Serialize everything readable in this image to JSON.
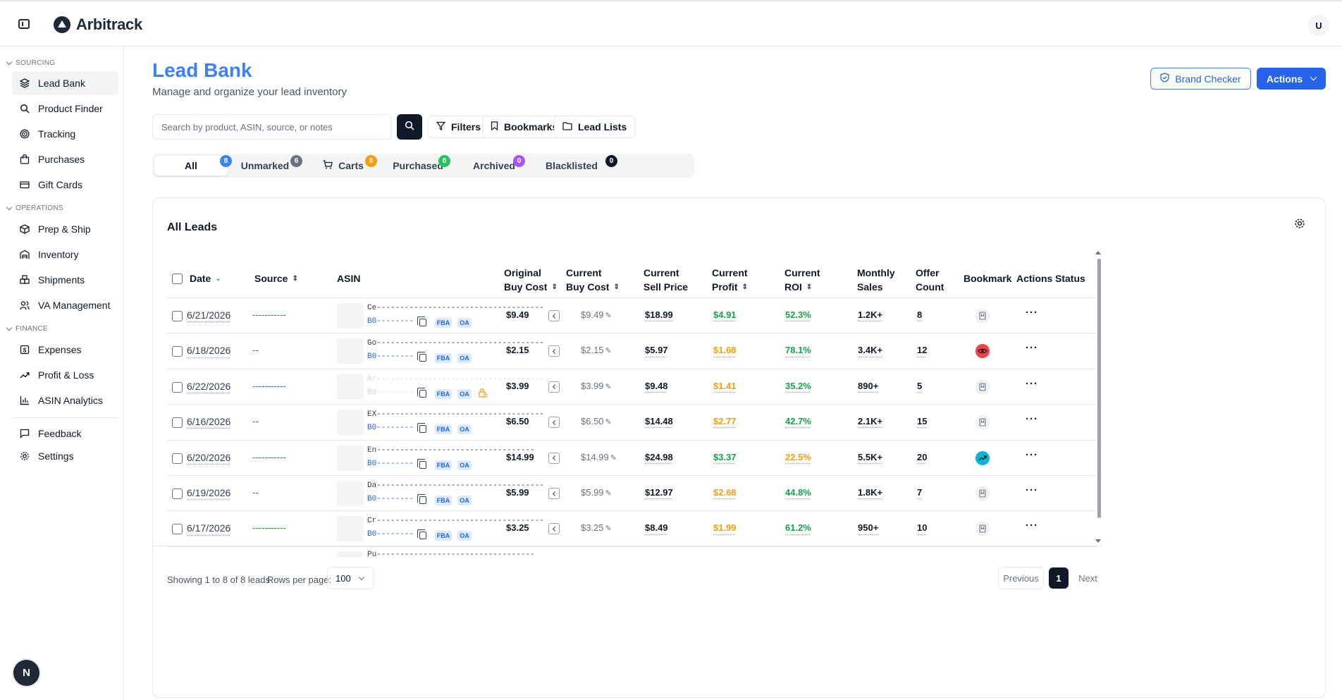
{
  "app": {
    "name": "Arbitrack",
    "user_initial": "U",
    "dev_badge": "N"
  },
  "sidebar": {
    "sections": [
      {
        "title": "SOURCING",
        "items": [
          "Lead Bank",
          "Product Finder",
          "Tracking",
          "Purchases",
          "Gift Cards"
        ]
      },
      {
        "title": "OPERATIONS",
        "items": [
          "Prep & Ship",
          "Inventory",
          "Shipments",
          "VA Management"
        ]
      },
      {
        "title": "FINANCE",
        "items": [
          "Expenses",
          "Profit & Loss",
          "ASIN Analytics"
        ]
      }
    ],
    "footer_items": [
      "Feedback",
      "Settings"
    ]
  },
  "header": {
    "title": "Lead Bank",
    "subtitle": "Manage and organize your lead inventory",
    "brand_checker": "Brand Checker",
    "actions": "Actions"
  },
  "toolbar": {
    "search_placeholder": "Search by product, ASIN, source, or notes",
    "filters": "Filters",
    "bookmarks": "Bookmarks",
    "lead_lists": "Lead Lists"
  },
  "tabs": [
    {
      "label": "All",
      "count": "8",
      "color": "#3b82f6"
    },
    {
      "label": "Unmarked",
      "count": "6",
      "color": "#6b7280"
    },
    {
      "label": "Carts",
      "count": "0",
      "color": "#f59e0b"
    },
    {
      "label": "Purchased",
      "count": "0",
      "color": "#22c55e"
    },
    {
      "label": "Archived",
      "count": "0",
      "color": "#a855f7"
    },
    {
      "label": "Blacklisted",
      "count": "0",
      "color": "#111827"
    }
  ],
  "table": {
    "title": "All Leads",
    "headers": {
      "date": "Date",
      "source": "Source",
      "asin": "ASIN",
      "orig_buy_1": "Original",
      "orig_buy_2": "Buy Cost",
      "cur_buy_1": "Current",
      "cur_buy_2": "Buy Cost",
      "sell_1": "Current",
      "sell_2": "Sell Price",
      "profit_1": "Current",
      "profit_2": "Profit",
      "roi_1": "Current",
      "roi_2": "ROI",
      "sales_1": "Monthly",
      "sales_2": "Sales",
      "offer_1": "Offer",
      "offer_2": "Count",
      "bookmark": "Bookmark",
      "actions": "Actions",
      "status": "Status"
    },
    "rows": [
      {
        "date": "6/21/2026",
        "source": "-----------",
        "title": "Ce------------------------------------",
        "asin": "B0--------",
        "chips": [
          "FBA",
          "OA"
        ],
        "orig_buy": "$9.49",
        "cur_buy": "$9.49",
        "sell": "$18.99",
        "profit": "$4.91",
        "profit_color": "green",
        "roi": "52.3%",
        "roi_color": "green",
        "sales": "1.2K+",
        "offers": "8",
        "bookmark": "plain"
      },
      {
        "date": "6/18/2026",
        "source": "--",
        "title": "Go------------------------------------",
        "asin": "B0--------",
        "chips": [
          "FBA",
          "OA"
        ],
        "orig_buy": "$2.15",
        "cur_buy": "$2.15",
        "sell": "$5.97",
        "profit": "$1.68",
        "profit_color": "orange",
        "roi": "78.1%",
        "roi_color": "green",
        "sales": "3.4K+",
        "offers": "12",
        "bookmark": "watch"
      },
      {
        "date": "6/22/2026",
        "source": "-----------",
        "title": "Ar------------------------------------",
        "asin": "B0--------",
        "chips": [
          "FBA",
          "OA"
        ],
        "orig_buy": "$3.99",
        "cur_buy": "$3.99",
        "sell": "$9.48",
        "profit": "$1.41",
        "profit_color": "orange",
        "roi": "35.2%",
        "roi_color": "green",
        "sales": "890+",
        "offers": "5",
        "bookmark": "plain"
      },
      {
        "date": "6/16/2026",
        "source": "--",
        "title": "EX------------------------------------",
        "asin": "B0--------",
        "chips": [
          "FBA",
          "OA"
        ],
        "orig_buy": "$6.50",
        "cur_buy": "$6.50",
        "sell": "$14.48",
        "profit": "$2.77",
        "profit_color": "orange",
        "roi": "42.7%",
        "roi_color": "green",
        "sales": "2.1K+",
        "offers": "15",
        "bookmark": "plain"
      },
      {
        "date": "6/20/2026",
        "source": "-----------",
        "title": "En----------------------------------",
        "asin": "B0--------",
        "chips": [
          "FBA",
          "OA"
        ],
        "orig_buy": "$14.99",
        "cur_buy": "$14.99",
        "sell": "$24.98",
        "profit": "$3.37",
        "profit_color": "green",
        "roi": "22.5%",
        "roi_color": "orange",
        "sales": "5.5K+",
        "offers": "20",
        "bookmark": "trend"
      },
      {
        "date": "6/19/2026",
        "source": "--",
        "title": "Da------------------------------------",
        "asin": "B0--------",
        "chips": [
          "FBA",
          "OA"
        ],
        "orig_buy": "$5.99",
        "cur_buy": "$5.99",
        "sell": "$12.97",
        "profit": "$2.68",
        "profit_color": "orange",
        "roi": "44.8%",
        "roi_color": "green",
        "sales": "1.8K+",
        "offers": "7",
        "bookmark": "plain"
      },
      {
        "date": "6/17/2026",
        "source": "-----------",
        "title": "Cr------------------------------------",
        "asin": "B0--------",
        "chips": [
          "FBA",
          "OA"
        ],
        "orig_buy": "$3.25",
        "cur_buy": "$3.25",
        "sell": "$8.49",
        "profit": "$1.99",
        "profit_color": "orange",
        "roi": "61.2%",
        "roi_color": "green",
        "sales": "950+",
        "offers": "10",
        "bookmark": "plain"
      }
    ],
    "partial_row_title": "Pu----------------------------------"
  },
  "footer": {
    "showing": "Showing 1 to 8 of 8 leads",
    "rows_per_page_label": "Rows per page:",
    "rows_per_page": "100",
    "previous": "Previous",
    "page": "1",
    "next": "Next"
  },
  "colors": {
    "accent": "#2563eb",
    "title": "#3b82f6",
    "green": "#16a34a",
    "orange": "#f59e0b",
    "watch": "#ef4444",
    "trend": "#06b6d4"
  }
}
